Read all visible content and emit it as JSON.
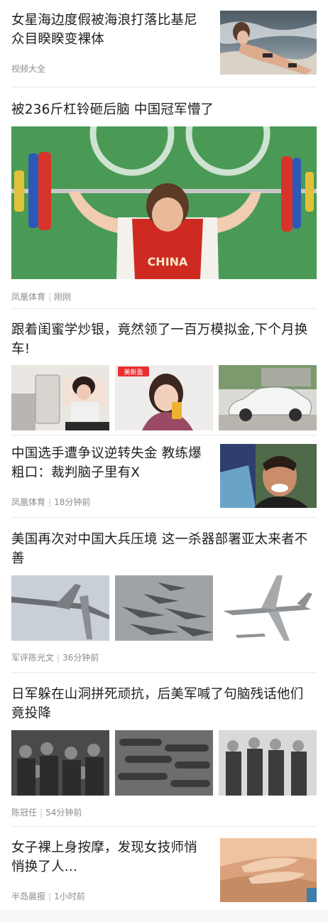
{
  "articles": [
    {
      "title": "女星海边度假被海浪打落比基尼众目睽睽变裸体",
      "source": "视频大全",
      "time": "",
      "image": "beach-photo"
    },
    {
      "title": "被236斤杠铃砸后脑 中国冠军懵了",
      "source": "凤凰体育",
      "time": "刚刚",
      "image": "weightlifter-photo",
      "jersey_text": "CHINA"
    },
    {
      "title": "跟着闺蜜学炒银，竟然领了一百万模拟金,下个月换车!",
      "source": "",
      "time": "",
      "images": [
        "silver-bars-photo",
        "phone-girl-photo",
        "white-car-photo"
      ],
      "ad_logo_text": "美新盈"
    },
    {
      "title": "中国选手遭争议逆转失金 教练爆粗口：裁判脑子里有X",
      "source": "凤凰体育",
      "time": "18分钟前",
      "image": "coach-photo"
    },
    {
      "title": "美国再次对中国大兵压境 这一杀器部署亚太来者不善",
      "source": "军评陈光文",
      "time": "36分钟前",
      "images": [
        "bomber-flight-photo",
        "bombers-parked-photo",
        "bomber-drawing"
      ]
    },
    {
      "title": "日军躲在山洞拼死顽抗，后美军喊了句脑残话他们竟投降",
      "source": "陈冠任",
      "time": "54分钟前",
      "images": [
        "soldiers-group-photo",
        "soldiers-prone-photo",
        "officers-photo"
      ]
    },
    {
      "title": "女子裸上身按摩，发现女技师悄悄换了人...",
      "source": "半岛晨报",
      "time": "1小时前",
      "image": "massage-photo"
    }
  ]
}
